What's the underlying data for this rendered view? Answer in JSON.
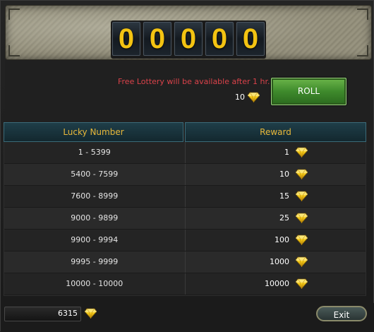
{
  "display": {
    "digits": [
      "0",
      "0",
      "0",
      "0",
      "0"
    ]
  },
  "lottery": {
    "free_message": "Free Lottery will be available after 1 hr.",
    "cost": "10",
    "cost_icon": "gem-icon",
    "roll_label": "ROLL"
  },
  "table": {
    "headers": [
      "Lucky Number",
      "Reward"
    ],
    "rows": [
      {
        "range": "1 - 5399",
        "reward": "1"
      },
      {
        "range": "5400 - 7599",
        "reward": "10"
      },
      {
        "range": "7600 - 8999",
        "reward": "15"
      },
      {
        "range": "9000 - 9899",
        "reward": "25"
      },
      {
        "range": "9900 - 9994",
        "reward": "100"
      },
      {
        "range": "9995 - 9999",
        "reward": "1000"
      },
      {
        "range": "10000 - 10000",
        "reward": "10000"
      }
    ]
  },
  "footer": {
    "balance": "6315",
    "exit_label": "Exit"
  },
  "colors": {
    "digit": "#f3c312",
    "header_text": "#e8b83a",
    "free_message": "#d9424a",
    "roll_button": "#3e8a2c"
  }
}
